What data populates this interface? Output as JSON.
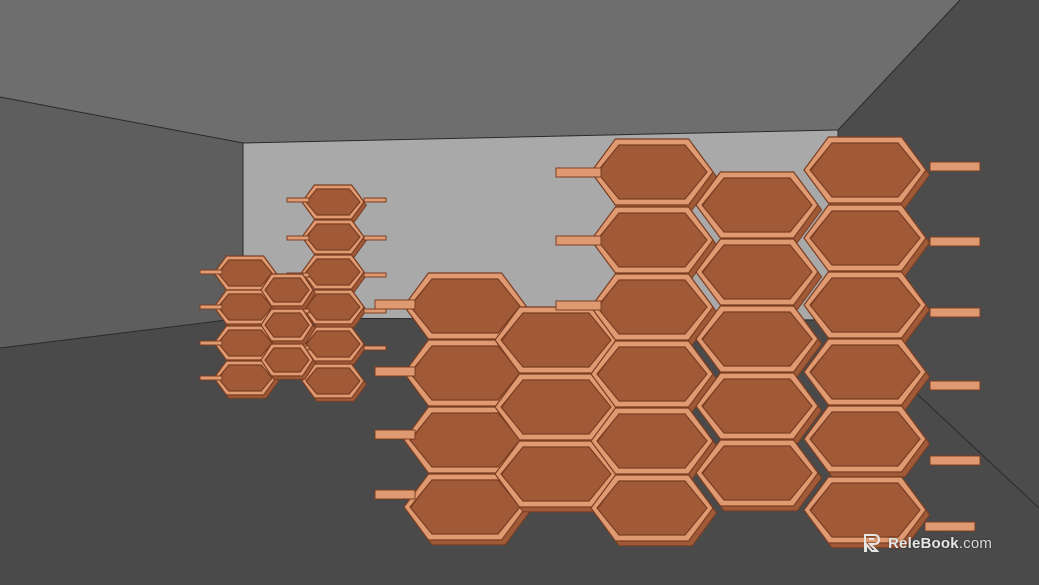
{
  "scene": {
    "description_colors": {
      "ceiling": "#6e6e6e",
      "left_wall": "#5e5e5e",
      "right_wall": "#4d4d4d",
      "back_wall": "#a8a8a8",
      "floor": "#4a4a4a",
      "shelf_face": "#e09a72",
      "shelf_edge": "#7a3e22",
      "shelf_inner": "#a05a38"
    }
  },
  "watermark": {
    "brand": "ReleBook",
    "tld": ".com"
  }
}
